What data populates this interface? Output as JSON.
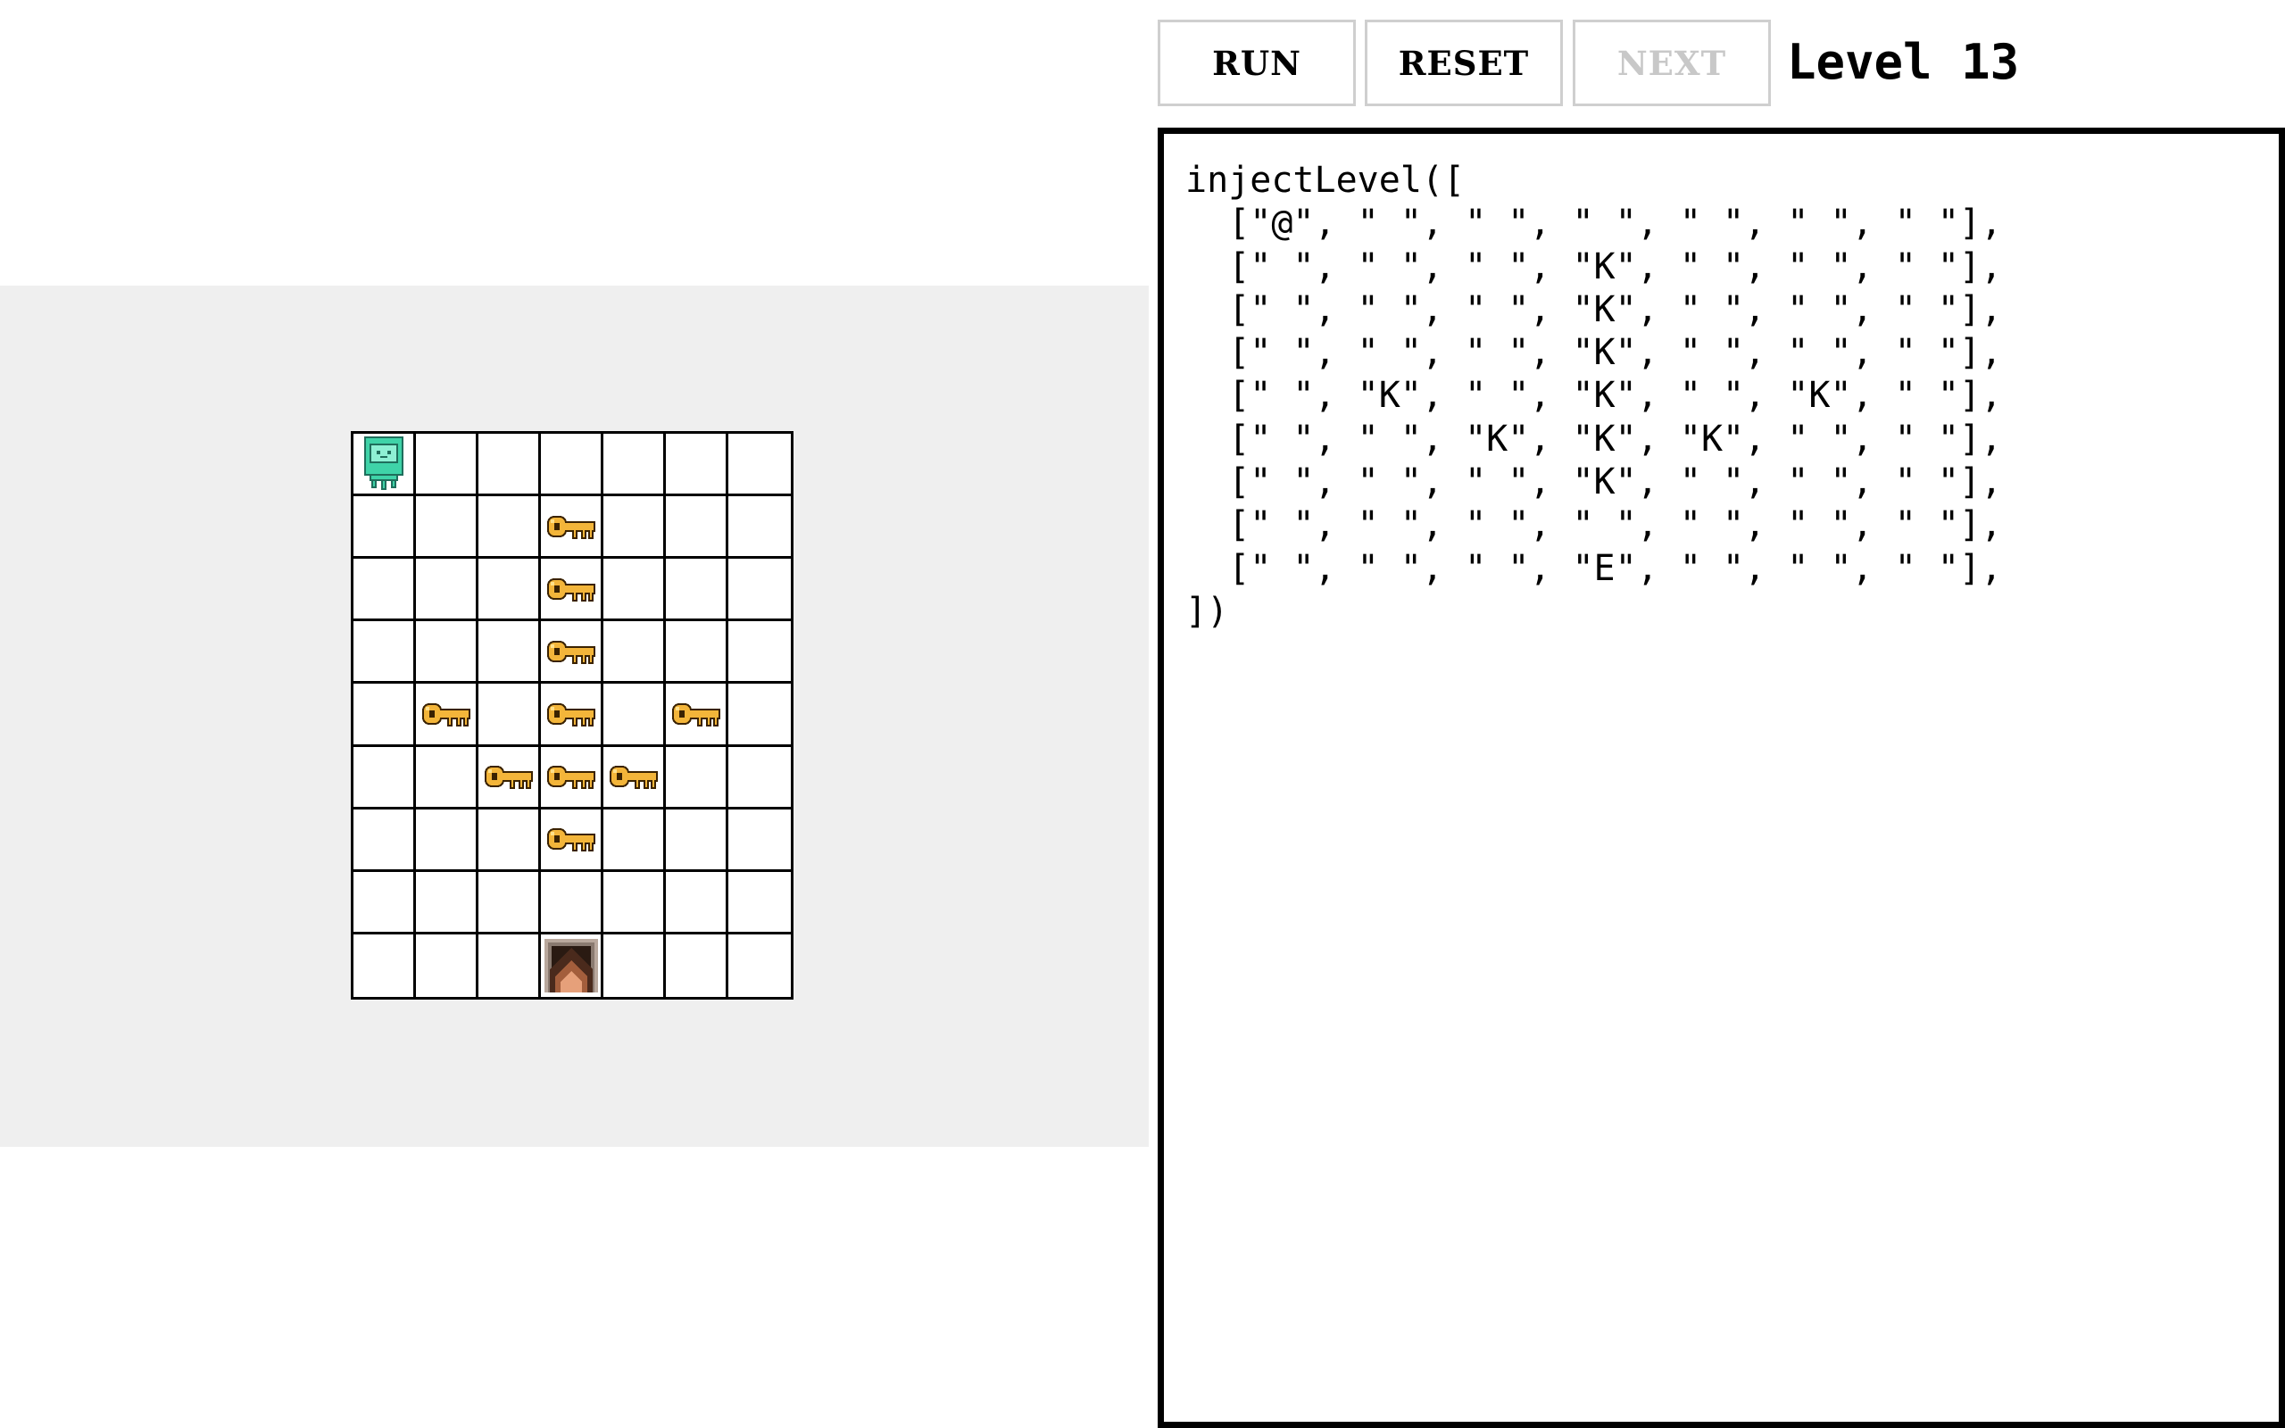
{
  "toolbar": {
    "run_label": "RUN",
    "reset_label": "RESET",
    "next_label": "NEXT",
    "level_title": "Level 13"
  },
  "editor": {
    "code": "injectLevel([\n  [\"@\", \" \", \" \", \" \", \" \", \" \", \" \"],\n  [\" \", \" \", \" \", \"K\", \" \", \" \", \" \"],\n  [\" \", \" \", \" \", \"K\", \" \", \" \", \" \"],\n  [\" \", \" \", \" \", \"K\", \" \", \" \", \" \"],\n  [\" \", \"K\", \" \", \"K\", \" \", \"K\", \" \"],\n  [\" \", \" \", \"K\", \"K\", \"K\", \" \", \" \"],\n  [\" \", \" \", \" \", \"K\", \" \", \" \", \" \"],\n  [\" \", \" \", \" \", \" \", \" \", \" \", \" \"],\n  [\" \", \" \", \" \", \"E\", \" \", \" \", \" \"],\n])"
  },
  "board": {
    "cols": 7,
    "rows": 9,
    "grid": [
      [
        "@",
        " ",
        " ",
        " ",
        " ",
        " ",
        " "
      ],
      [
        " ",
        " ",
        " ",
        "K",
        " ",
        " ",
        " "
      ],
      [
        " ",
        " ",
        " ",
        "K",
        " ",
        " ",
        " "
      ],
      [
        " ",
        " ",
        " ",
        "K",
        " ",
        " ",
        " "
      ],
      [
        " ",
        "K",
        " ",
        "K",
        " ",
        "K",
        " "
      ],
      [
        " ",
        " ",
        "K",
        "K",
        "K",
        " ",
        " "
      ],
      [
        " ",
        " ",
        " ",
        "K",
        " ",
        " ",
        " "
      ],
      [
        " ",
        " ",
        " ",
        " ",
        " ",
        " ",
        " "
      ],
      [
        " ",
        " ",
        " ",
        "E",
        " ",
        " ",
        " "
      ]
    ],
    "legend": {
      "@": "robot-icon",
      "K": "key-icon",
      "E": "exit-door-icon"
    }
  },
  "colors": {
    "panel_bg": "#efefef",
    "key_gold": "#f3b53a",
    "robot_teal": "#3fd3a8",
    "door_brown": "#5a3321",
    "disabled_text": "#c8c8c8"
  }
}
